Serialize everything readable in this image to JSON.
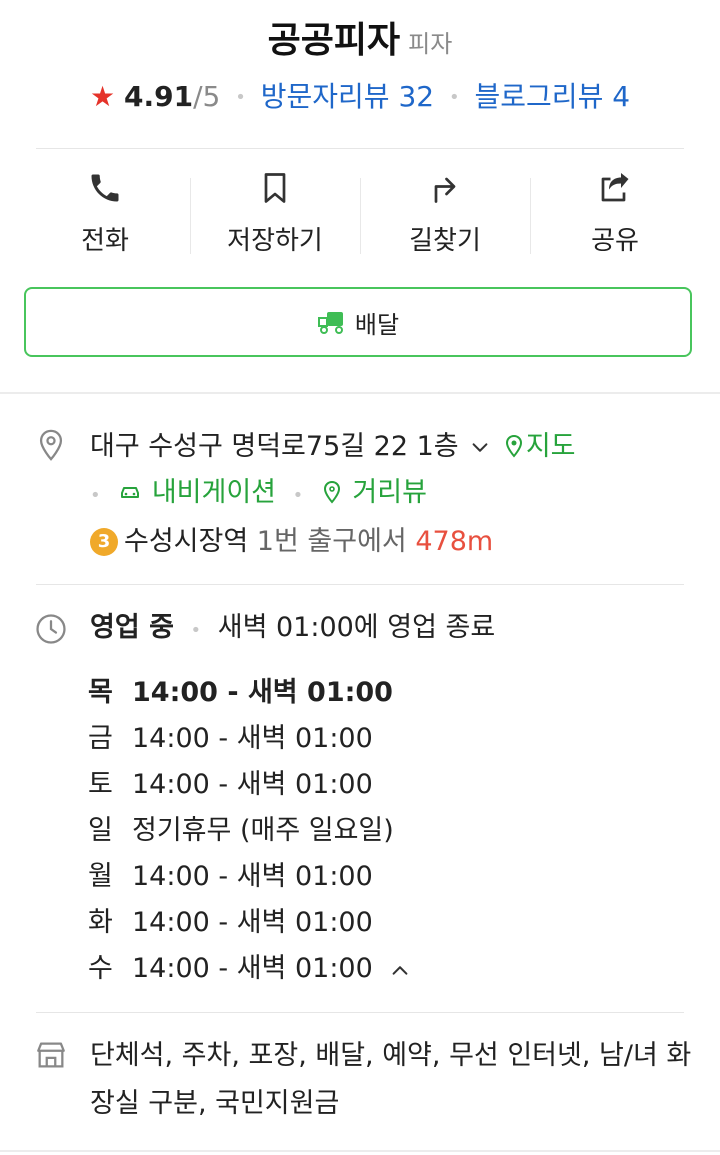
{
  "place": {
    "name": "공공피자",
    "category": "피자",
    "rating": "4.91",
    "rating_suffix": "/5",
    "visitor_reviews": "방문자리뷰 32",
    "blog_reviews": "블로그리뷰 4"
  },
  "actions": [
    {
      "label": "전화",
      "icon": "phone-icon"
    },
    {
      "label": "저장하기",
      "icon": "bookmark-icon"
    },
    {
      "label": "길찾기",
      "icon": "directions-icon"
    },
    {
      "label": "공유",
      "icon": "share-icon"
    }
  ],
  "delivery": {
    "label": "배달",
    "icon": "delivery-truck-icon"
  },
  "address": {
    "text": "대구 수성구 명덕로75길 22 1층",
    "map_link": "지도",
    "navigation_link": "내비게이션",
    "streetview_link": "거리뷰",
    "station_line": "3",
    "station_name": "수성시장역",
    "exit_text": "1번 출구에서",
    "distance": "478m"
  },
  "hours": {
    "status": "영업 중",
    "closing_note": "새벽 01:00에 영업 종료",
    "days": [
      {
        "day": "목",
        "time": "14:00 - 새벽 01:00"
      },
      {
        "day": "금",
        "time": "14:00 - 새벽 01:00"
      },
      {
        "day": "토",
        "time": "14:00 - 새벽 01:00"
      },
      {
        "day": "일",
        "time": "정기휴무 (매주 일요일)"
      },
      {
        "day": "월",
        "time": "14:00 - 새벽 01:00"
      },
      {
        "day": "화",
        "time": "14:00 - 새벽 01:00"
      },
      {
        "day": "수",
        "time": "14:00 - 새벽 01:00"
      }
    ]
  },
  "facilities": "단체석, 주차, 포장, 배달, 예약, 무선 인터넷, 남/녀 화장실 구분, 국민지원금",
  "colors": {
    "accent_green": "#27a33c",
    "link_blue": "#1f67c9",
    "star_red": "#e5332a",
    "distance_red": "#e8503f"
  }
}
